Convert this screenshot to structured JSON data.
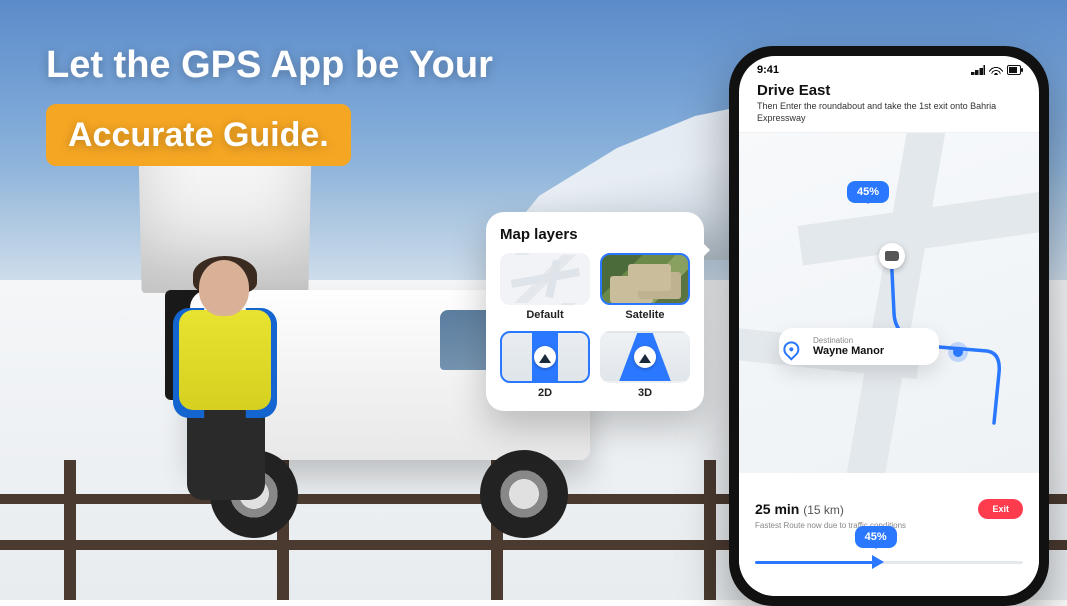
{
  "hero": {
    "line1": "Let the GPS App be Your",
    "badge": "Accurate Guide."
  },
  "layers_panel": {
    "title": "Map layers",
    "options": {
      "default": "Default",
      "satellite": "Satelite",
      "two_d": "2D",
      "three_d": "3D"
    }
  },
  "phone": {
    "status": {
      "time": "9:41"
    },
    "direction": {
      "title": "Drive East",
      "subtitle": "Then Enter the roundabout and take the 1st exit onto Bahria Expressway"
    },
    "map": {
      "percent_top": "45%",
      "destination_label": "Destination",
      "destination_name": "Wayne Manor"
    },
    "bottom": {
      "eta_time": "25 min",
      "eta_distance": "(15 km)",
      "exit_label": "Exit",
      "route_note": "Fastest Route now due to traffic conditions",
      "progress_pct": "45%",
      "progress_value": 45
    }
  }
}
